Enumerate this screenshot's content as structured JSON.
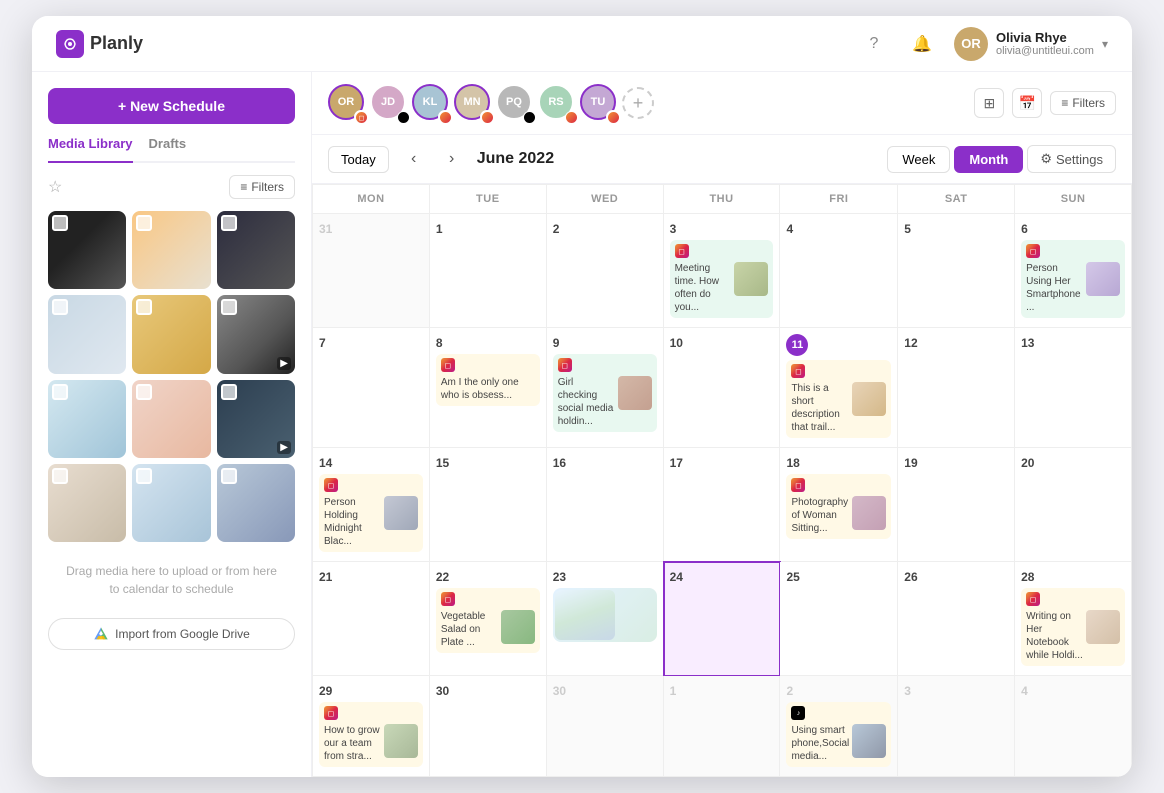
{
  "app": {
    "name": "Planly"
  },
  "user": {
    "name": "Olivia Rhye",
    "email": "olivia@untitleui.com",
    "avatar_initials": "OR"
  },
  "nav_icons": {
    "help": "?",
    "bell": "🔔"
  },
  "sidebar": {
    "new_schedule_label": "+ New Schedule",
    "tabs": [
      {
        "label": "Media Library",
        "active": true
      },
      {
        "label": "Drafts",
        "active": false
      }
    ],
    "filter_label": "Filters",
    "drag_hint": "Drag media here to upload or from here\nto calendar to schedule",
    "import_label": "Import from Google Drive"
  },
  "calendar": {
    "today_label": "Today",
    "month_title": "June 2022",
    "week_label": "Week",
    "month_label": "Month",
    "settings_label": "Settings",
    "filters_label": "Filters",
    "day_headers": [
      "MON",
      "TUE",
      "WED",
      "THU",
      "FRI",
      "SAT",
      "SUN"
    ],
    "weeks": [
      {
        "days": [
          {
            "date": "31",
            "outside": true,
            "events": []
          },
          {
            "date": "1",
            "events": []
          },
          {
            "date": "2",
            "events": []
          },
          {
            "date": "3",
            "events": [
              {
                "id": "e1",
                "type": "instagram",
                "text": "Meeting time. How often do you...",
                "has_image": true,
                "color": "green"
              }
            ]
          },
          {
            "date": "4",
            "events": []
          },
          {
            "date": "5",
            "events": []
          },
          {
            "date": "6",
            "events": [
              {
                "id": "e2",
                "type": "instagram",
                "text": "Person Using Her Smartphone ...",
                "has_image": true,
                "color": "green"
              }
            ]
          }
        ]
      },
      {
        "days": [
          {
            "date": "7",
            "events": []
          },
          {
            "date": "8",
            "events": [
              {
                "id": "e3",
                "type": "instagram",
                "text": "Am I the only one who is obsess...",
                "has_image": false,
                "color": "yellow"
              }
            ]
          },
          {
            "date": "9",
            "events": [
              {
                "id": "e4",
                "type": "instagram",
                "text": "Girl checking social media holdin...",
                "has_image": true,
                "color": "green"
              }
            ]
          },
          {
            "date": "10",
            "events": []
          },
          {
            "date": "11",
            "today": true,
            "events": [
              {
                "id": "e5",
                "type": "instagram",
                "text": "This is a short description that trail...",
                "has_image": true,
                "color": "yellow"
              }
            ]
          },
          {
            "date": "12",
            "events": []
          },
          {
            "date": "13",
            "events": []
          }
        ]
      },
      {
        "days": [
          {
            "date": "14",
            "events": [
              {
                "id": "e6",
                "type": "instagram",
                "text": "Person Holding Midnight Blac...",
                "has_image": true,
                "color": "yellow"
              }
            ]
          },
          {
            "date": "15",
            "events": []
          },
          {
            "date": "16",
            "events": []
          },
          {
            "date": "17",
            "events": []
          },
          {
            "date": "18",
            "events": [
              {
                "id": "e7",
                "type": "instagram",
                "text": "Photography of Woman Sitting...",
                "has_image": true,
                "color": "yellow"
              }
            ]
          },
          {
            "date": "19",
            "events": []
          },
          {
            "date": "20",
            "events": []
          }
        ]
      },
      {
        "days": [
          {
            "date": "21",
            "events": []
          },
          {
            "date": "22",
            "events": [
              {
                "id": "e8",
                "type": "instagram",
                "text": "Vegetable Salad on Plate ...",
                "has_image": true,
                "color": "yellow"
              }
            ]
          },
          {
            "date": "23",
            "events": [
              {
                "id": "e9",
                "type": "none",
                "text": "",
                "has_image": true,
                "color": "green",
                "landscape": true
              }
            ]
          },
          {
            "date": "24",
            "highlighted": true,
            "events": []
          },
          {
            "date": "25",
            "events": []
          },
          {
            "date": "26",
            "events": []
          },
          {
            "date": "28",
            "events": [
              {
                "id": "e10",
                "type": "instagram",
                "text": "Writing on Her Notebook while Holdi...",
                "has_image": true,
                "color": "yellow"
              }
            ]
          }
        ]
      },
      {
        "days": [
          {
            "date": "29",
            "events": [
              {
                "id": "e11",
                "type": "instagram",
                "text": "How to grow our a team from stra...",
                "has_image": true,
                "color": "yellow"
              }
            ]
          },
          {
            "date": "30",
            "events": []
          },
          {
            "date": "30",
            "outside": true,
            "events": []
          },
          {
            "date": "1",
            "outside": true,
            "events": []
          },
          {
            "date": "2",
            "outside": true,
            "events": [
              {
                "id": "e12",
                "type": "tiktok",
                "text": "Using smart phone,Social media...",
                "has_image": true,
                "color": "yellow"
              }
            ]
          },
          {
            "date": "3",
            "outside": true,
            "events": []
          },
          {
            "date": "4",
            "outside": true,
            "events": []
          }
        ]
      }
    ],
    "avatars": [
      {
        "initials": "OR",
        "bg": "#c9a86c",
        "social": "instagram",
        "checked": true
      },
      {
        "initials": "JD",
        "bg": "#d4a8c7",
        "social": "tiktok",
        "checked": false
      },
      {
        "initials": "KL",
        "bg": "#a8c4d4",
        "social": "instagram",
        "checked": true
      },
      {
        "initials": "MN",
        "bg": "#d4c4a8",
        "social": "instagram",
        "checked": true
      },
      {
        "initials": "PQ",
        "bg": "#b8b8b8",
        "social": "tiktok",
        "checked": false
      },
      {
        "initials": "RS",
        "bg": "#a8d4b8",
        "social": "instagram",
        "checked": false
      },
      {
        "initials": "TU",
        "bg": "#c4a8d4",
        "social": "instagram",
        "checked": true
      }
    ]
  }
}
